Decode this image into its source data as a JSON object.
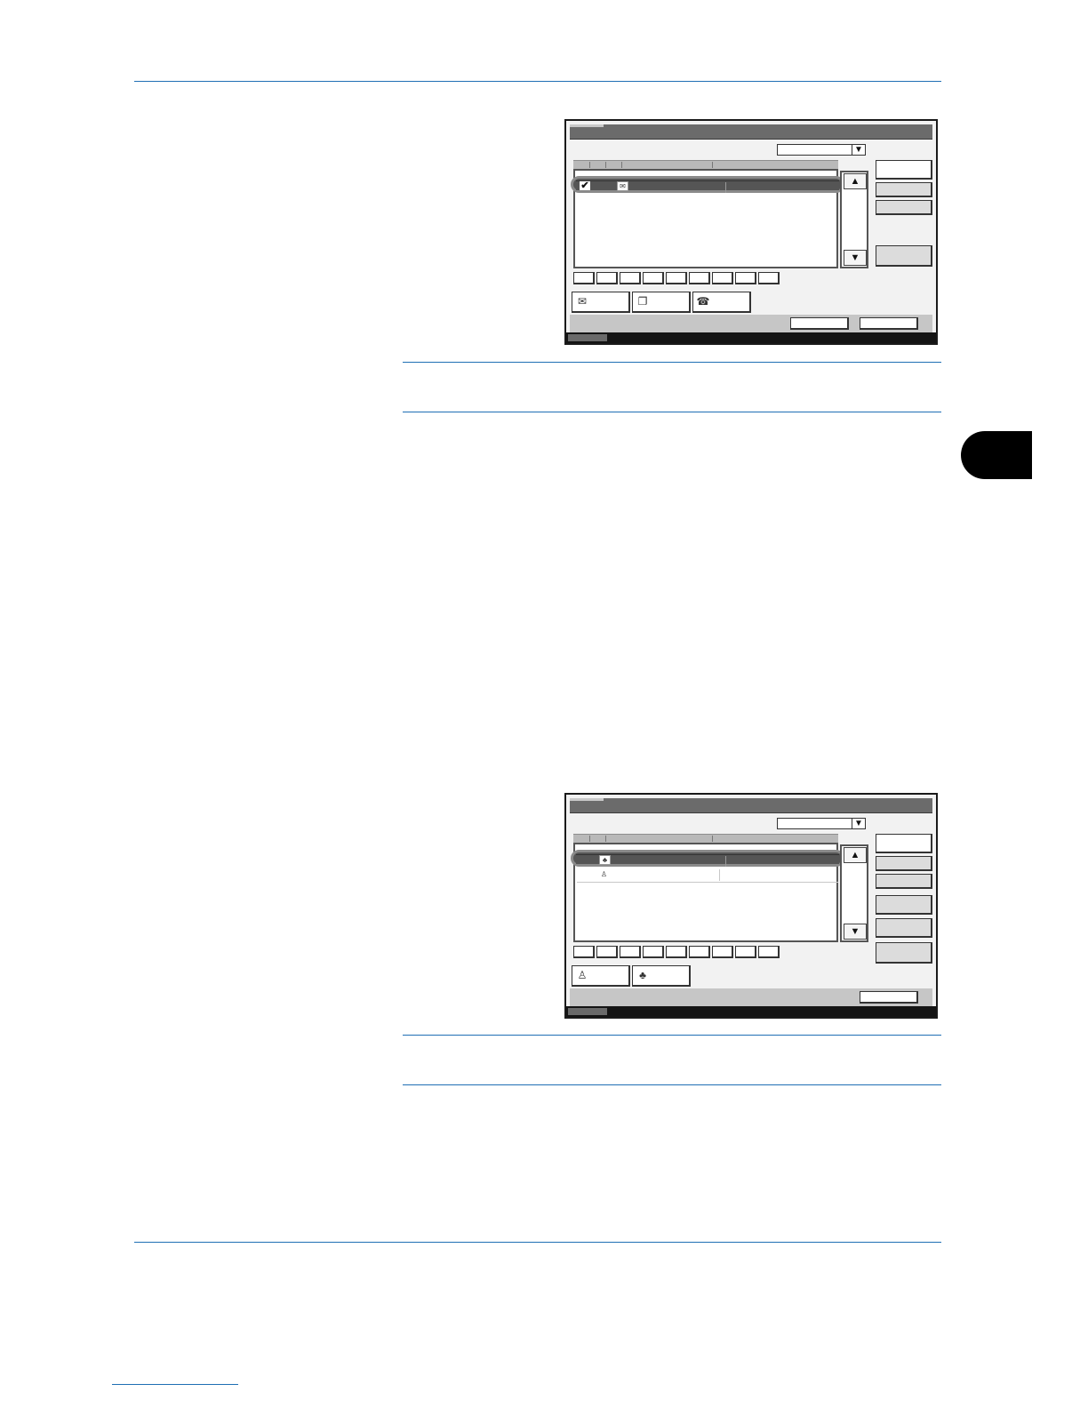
{
  "page": {
    "header_rule": true,
    "footer_rule": true,
    "section_tab": ""
  },
  "screens": [
    {
      "name": "destination-select-screen-1",
      "dropdown_value": "",
      "list_rows": [
        {
          "selected": true,
          "icon": "email-icon",
          "col1": "",
          "col2": ""
        }
      ],
      "alpha_keys": [
        "",
        "",
        "",
        "",
        "",
        "",
        "",
        "",
        ""
      ],
      "type_buttons": [
        {
          "icon": "email-icon",
          "label": ""
        },
        {
          "icon": "folder-icon",
          "label": ""
        },
        {
          "icon": "fax-icon",
          "label": ""
        }
      ],
      "side_buttons": [
        "",
        "",
        "",
        ""
      ],
      "bottom_buttons": [
        "",
        ""
      ]
    },
    {
      "name": "destination-select-screen-2",
      "dropdown_value": "",
      "list_rows": [
        {
          "selected": true,
          "icon": "group-icon",
          "col1": "",
          "col2": ""
        },
        {
          "selected": false,
          "icon": "person-icon",
          "col1": "",
          "col2": ""
        }
      ],
      "alpha_keys": [
        "",
        "",
        "",
        "",
        "",
        "",
        "",
        "",
        ""
      ],
      "type_buttons": [
        {
          "icon": "person-icon",
          "label": ""
        },
        {
          "icon": "group-icon",
          "label": ""
        }
      ],
      "side_buttons": [
        "",
        "",
        "",
        "",
        "",
        ""
      ],
      "bottom_buttons": [
        ""
      ]
    }
  ],
  "notes": [
    {
      "text": ""
    },
    {
      "text": ""
    }
  ]
}
